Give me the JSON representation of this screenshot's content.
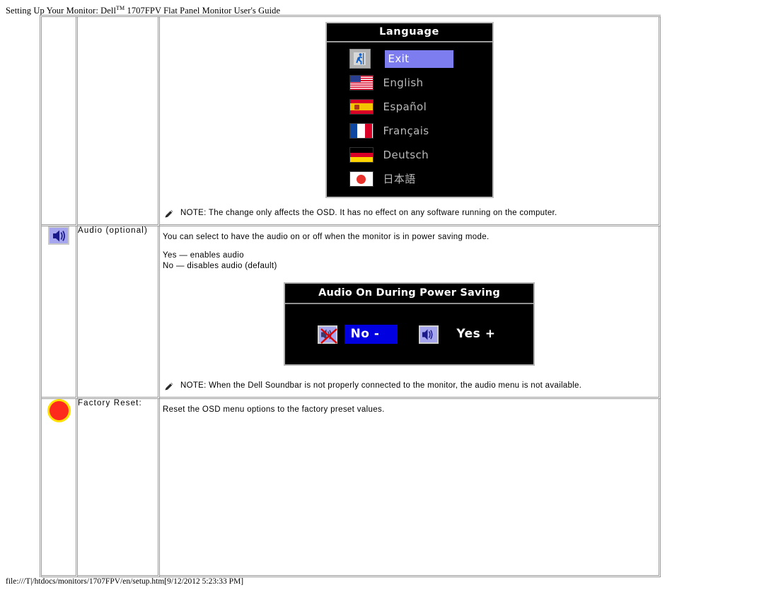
{
  "page": {
    "header_pre": "Setting Up Your Monitor: Dell",
    "header_tm": "TM",
    "header_post": " 1707FPV Flat Panel Monitor User's Guide",
    "footer": "file:///T|/htdocs/monitors/1707FPV/en/setup.htm[9/12/2012 5:23:33 PM]"
  },
  "colors": {
    "osd_highlight_blue": "#7d7df0",
    "osd_select_blue": "#0000e0",
    "icon_lavender": "#a6a6ee",
    "reset_red": "#fe2a1c",
    "reset_ring_yellow": "#ffe000",
    "table_border": "#999999"
  },
  "language_row": {
    "osd": {
      "title": "Language",
      "items": [
        {
          "icon": "exit-door-icon",
          "label": "Exit",
          "selected": true
        },
        {
          "icon": "flag-us-icon",
          "label": "English",
          "selected": false
        },
        {
          "icon": "flag-es-icon",
          "label": "Español",
          "selected": false
        },
        {
          "icon": "flag-fr-icon",
          "label": "Français",
          "selected": false
        },
        {
          "icon": "flag-de-icon",
          "label": "Deutsch",
          "selected": false
        },
        {
          "icon": "flag-jp-icon",
          "label": "日本語",
          "selected": false
        }
      ]
    },
    "note": "NOTE: The change only affects the OSD. It has no effect on any software running on the computer."
  },
  "audio_row": {
    "icon": "speaker-icon",
    "label": "Audio (optional)",
    "description": "You can select to have the audio on or off when the monitor is in power saving mode.",
    "option_yes": "Yes — enables audio",
    "option_no": "No — disables audio (default)",
    "osd": {
      "title": "Audio On During Power Saving",
      "no_label": "No -",
      "yes_label": "Yes +",
      "no_icon": "speaker-muted-icon",
      "yes_icon": "speaker-icon"
    },
    "note": "NOTE: When the Dell Soundbar is not properly connected to the monitor, the audio menu is not available."
  },
  "factory_reset_row": {
    "icon": "red-circle-icon",
    "label": "Factory Reset:",
    "description": "Reset the OSD menu options to  the factory preset values."
  }
}
